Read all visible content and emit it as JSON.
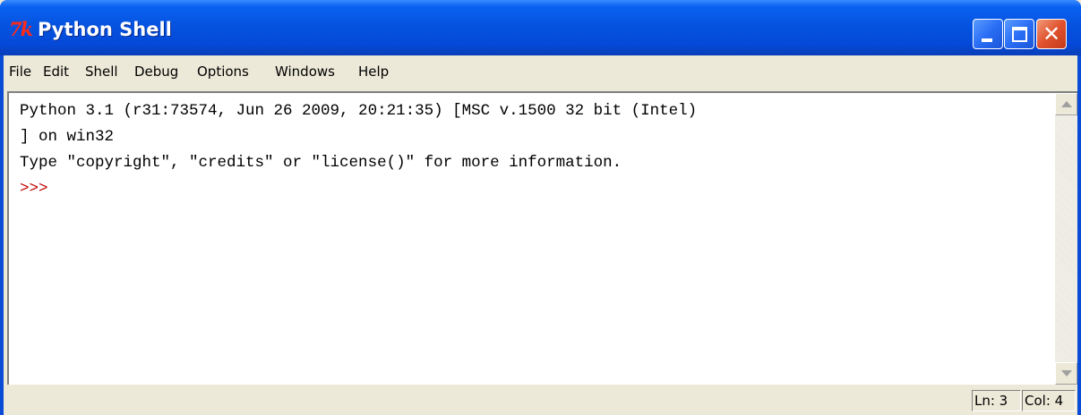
{
  "window": {
    "title": "Python Shell",
    "icon": "tk-icon",
    "icon_text": "7k"
  },
  "menu": {
    "items": [
      "File",
      "Edit",
      "Shell",
      "Debug",
      "Options",
      "Windows",
      "Help"
    ]
  },
  "shell": {
    "lines": [
      "Python 3.1 (r31:73574, Jun 26 2009, 20:21:35) [MSC v.1500 32 bit (Intel)",
      "] on win32",
      "Type \"copyright\", \"credits\" or \"license()\" for more information."
    ],
    "prompt": ">>>"
  },
  "status": {
    "ln": "Ln: 3",
    "col": "Col: 4"
  },
  "colors": {
    "titlebar": "#0553e0",
    "prompt": "#c00000",
    "close_button": "#e0522e"
  }
}
